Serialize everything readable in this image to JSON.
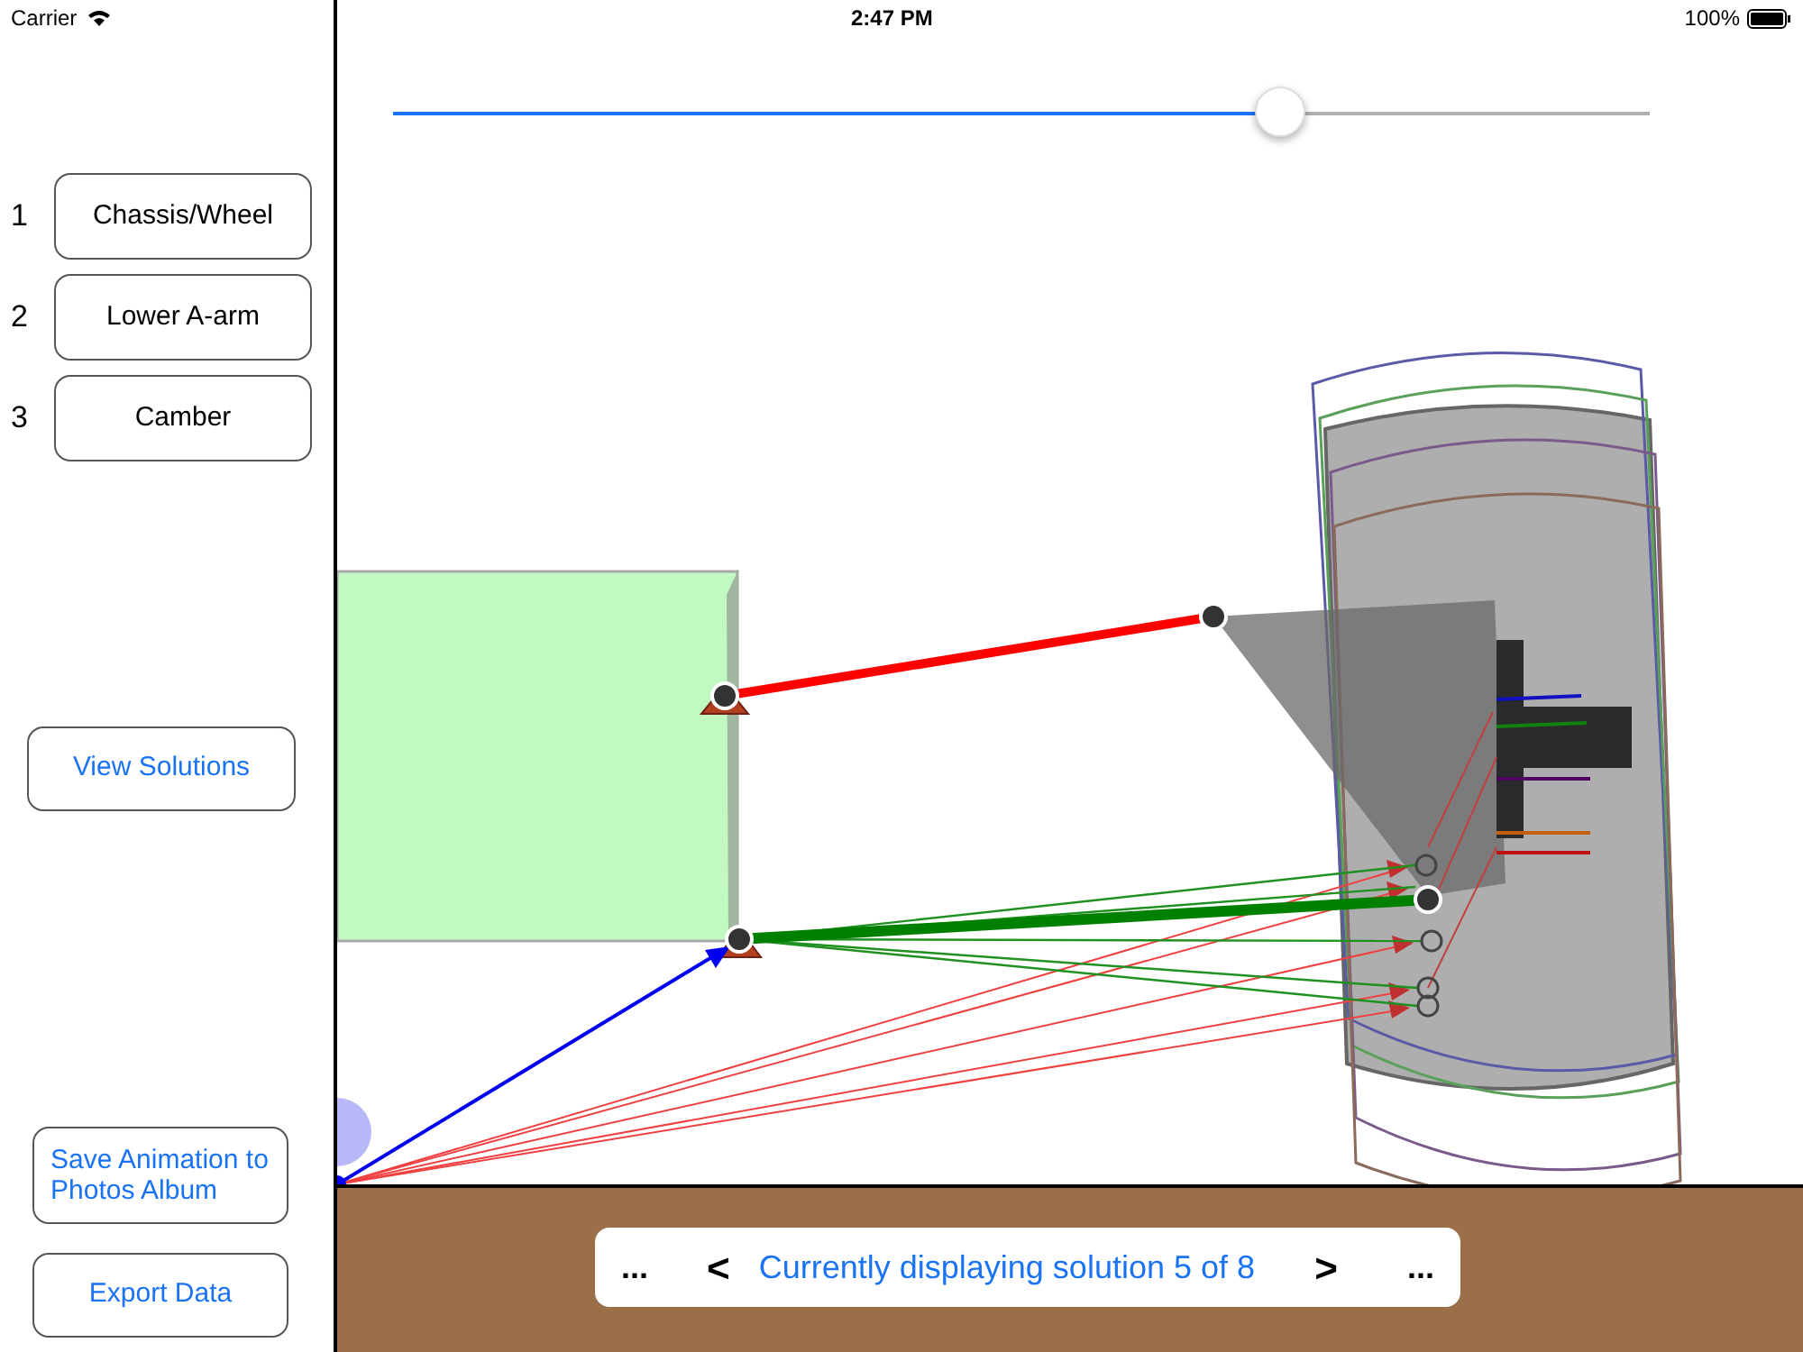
{
  "status_bar": {
    "carrier": "Carrier",
    "time": "2:47 PM",
    "battery": "100%"
  },
  "steps": [
    {
      "number": "1",
      "label": "Chassis/Wheel"
    },
    {
      "number": "2",
      "label": "Lower A-arm"
    },
    {
      "number": "3",
      "label": "Camber"
    }
  ],
  "view_solutions": "View Solutions",
  "save_animation": "Save Animation to Photos Album",
  "export_data": "Export Data",
  "slider": {
    "level": 0.706
  },
  "solution_bar": {
    "more_left": "...",
    "prev": "<",
    "text": "Currently displaying solution 5 of 8",
    "next": ">",
    "more_right": "..."
  }
}
